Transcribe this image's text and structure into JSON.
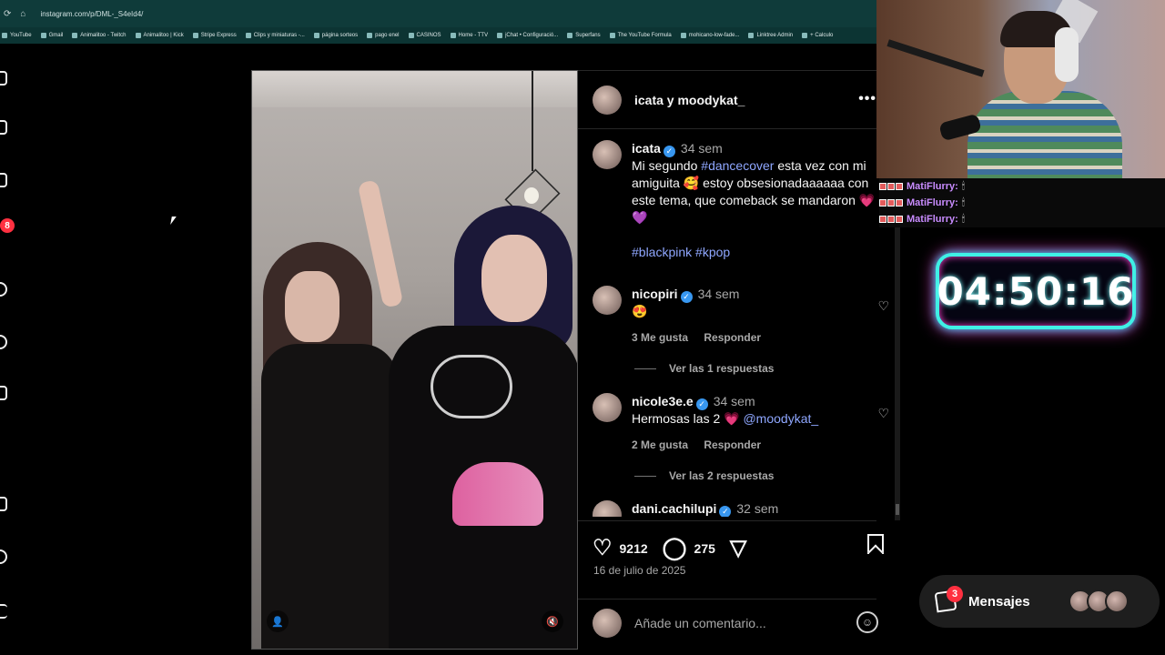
{
  "browser": {
    "url": "instagram.com/p/DML-_S4eId4/",
    "bookmarks": [
      "YouTube",
      "Gmail",
      "Animalitoo - Twitch",
      "Animalitoo | Kick",
      "Stripe Express",
      "Clips y miniaturas -...",
      "página sorteos",
      "pago enel",
      "CASINOS",
      "Home - TTV",
      "jChat • Configuració...",
      "Superfans",
      "The YouTube Formula",
      "mohicano-low-fade...",
      "Linktree Admin",
      "+ Calculo"
    ]
  },
  "rail": {
    "notification_count": "8"
  },
  "media": {
    "user_tag_icon": "person-icon",
    "mute_icon": "muted-speaker-icon"
  },
  "post": {
    "header_name": "icata y moodykat_",
    "more_label": "•••",
    "caption": {
      "user": "icata",
      "time": "34 sem",
      "text": "Mi segundo",
      "tag1": "#dancecover",
      "text2": "esta vez con mi amiguita 🥰 estoy obsesionadaaaaaa con este tema, que comeback se mandaron 💗 💜",
      "hashtags": "#blackpink #kpop"
    },
    "comments": [
      {
        "user": "nicopiri",
        "time": "34 sem",
        "text": "😍",
        "likes": "3 Me gusta",
        "reply": "Responder",
        "view_replies": "Ver las 1 respuestas"
      },
      {
        "user": "nicole3e.e",
        "time": "34 sem",
        "text": "Hermosas las 2 💗",
        "mention": "@moodykat_",
        "likes": "2 Me gusta",
        "reply": "Responder",
        "view_replies": "Ver las 2 respuestas"
      },
      {
        "user": "dani.cachilupi",
        "time": "32 sem"
      }
    ],
    "like_count": "9212",
    "comment_count": "275",
    "date": "16 de julio de 2025",
    "comment_placeholder": "Añade un comentario..."
  },
  "stream": {
    "chat": [
      {
        "user": "MatiFlurry:",
        "msg": "🕯"
      },
      {
        "user": "MatiFlurry:",
        "msg": "🕯"
      },
      {
        "user": "MatiFlurry:",
        "msg": "🕯"
      }
    ],
    "timer": "04:50:16",
    "messages_label": "Mensajes",
    "messages_badge": "3"
  },
  "colors": {
    "accent_link": "#8fa7ff",
    "verified": "#3897f0",
    "badge": "#ff3040",
    "timer_glow_cyan": "#3ff0e6",
    "timer_glow_pink": "#ff3fd0"
  }
}
